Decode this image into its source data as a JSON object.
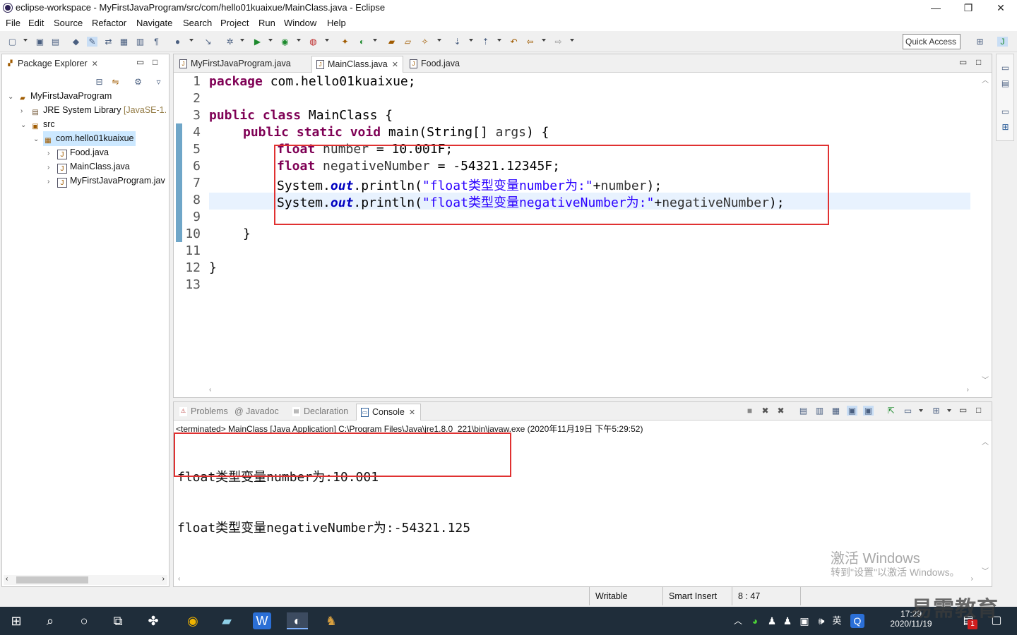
{
  "window": {
    "title": "eclipse-workspace - MyFirstJavaProgram/src/com/hello01kuaixue/MainClass.java - Eclipse",
    "minimize": "—",
    "maximize": "❐",
    "close": "✕"
  },
  "menu": [
    "File",
    "Edit",
    "Source",
    "Refactor",
    "Navigate",
    "Search",
    "Project",
    "Run",
    "Window",
    "Help"
  ],
  "toolbar": {
    "quick_access": "Quick Access"
  },
  "package_explorer": {
    "title": "Package Explorer",
    "tree": [
      {
        "arrow": "⌄",
        "label": "MyFirstJavaProgram",
        "extra": ""
      },
      {
        "arrow": "›",
        "label": "JRE System Library",
        "extra": "[JavaSE-1."
      },
      {
        "arrow": "⌄",
        "label": "src",
        "extra": ""
      },
      {
        "arrow": "⌄",
        "label": "com.hello01kuaixue",
        "extra": ""
      },
      {
        "arrow": "›",
        "label": "Food.java",
        "extra": ""
      },
      {
        "arrow": "›",
        "label": "MainClass.java",
        "extra": ""
      },
      {
        "arrow": "›",
        "label": "MyFirstJavaProgram.jav",
        "extra": ""
      }
    ]
  },
  "editor": {
    "tabs": [
      "MyFirstJavaProgram.java",
      "MainClass.java",
      "Food.java"
    ],
    "line_numbers": [
      "1",
      "2",
      "3",
      "4",
      "5",
      "6",
      "7",
      "8",
      "9",
      "10",
      "11",
      "12",
      "13"
    ],
    "code": {
      "l1_kw": "package",
      "l1_rest": " com.hello01kuaixue;",
      "l3_kw": "public class",
      "l3_rest": " MainClass {",
      "l4_kw": "public static void",
      "l4_rest": " main(String[] ",
      "l4_var": "args",
      "l4_end": ") {",
      "l5_kw": "float",
      "l5_var": " number",
      "l5_rest": " = 10.001F;",
      "l6_kw": "float",
      "l6_var": " negativeNumber",
      "l6_rest": " = -54321.12345F;",
      "l7_a": "System.",
      "l7_fld": "out",
      "l7_b": ".println(",
      "l7_str": "\"float类型变量number为:\"",
      "l7_c": "+",
      "l7_var": "number",
      "l7_d": ");",
      "l8_a": "System.",
      "l8_fld": "out",
      "l8_b": ".println(",
      "l8_str": "\"float类型变量negativeNumber为:\"",
      "l8_c": "+",
      "l8_var": "negativeNumber",
      "l8_d": ");",
      "l10": "}",
      "l12": "}"
    }
  },
  "console_panel": {
    "tabs": [
      "Problems",
      "@ Javadoc",
      "Declaration",
      "Console"
    ],
    "header": "<terminated> MainClass [Java Application] C:\\Program Files\\Java\\jre1.8.0_221\\bin\\javaw.exe (2020年11月19日 下午5:29:52)",
    "output": [
      "float类型变量number为:10.001",
      "float类型变量negativeNumber为:-54321.125"
    ],
    "watermark_1": "激活 Windows",
    "watermark_2": "转到\"设置\"以激活 Windows。"
  },
  "status": {
    "writable": "Writable",
    "insert": "Smart Insert",
    "position": "8 : 47"
  },
  "taskbar": {
    "time": "17:29",
    "date": "2020/11/19",
    "ime": "英",
    "brand": "易需教育",
    "notification_count": "1"
  },
  "colors": {
    "keyword": "#7f0055",
    "string": "#2a00ff",
    "field": "#0000c0",
    "highlight_box": "#e03131"
  }
}
